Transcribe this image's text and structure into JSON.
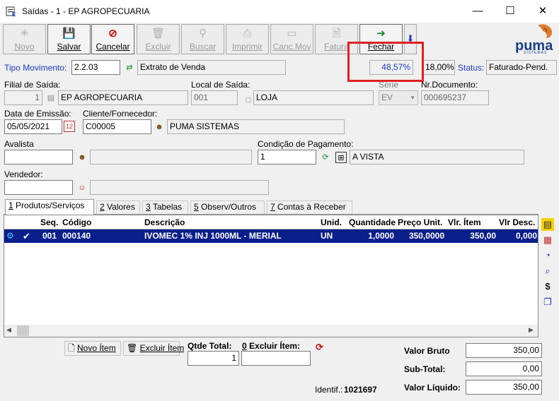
{
  "window": {
    "title": "Saídas - 1 - EP AGROPECUARIA",
    "controls": {
      "minimize": "—",
      "maximize": "☐",
      "close": "✕"
    }
  },
  "toolbar": {
    "novo": "Novo",
    "salvar": "Salvar",
    "cancelar": "Cancelar",
    "excluir": "Excluir",
    "buscar": "Buscar",
    "imprimir": "Imprimir",
    "canc_mov": "Canc.Mov",
    "fatura": "Fatura",
    "fechar": "Fechar",
    "logo_brand": "puma",
    "logo_sub": "SISTEMAS"
  },
  "header": {
    "tipo_label": "Tipo Movimento:",
    "tipo_value": "2.2.03",
    "tipo_desc": "Extrato de Venda",
    "pct1": "48,57%",
    "pct2": "18,00%",
    "status_label": "Status:",
    "status_value": "Faturado-Pend."
  },
  "form": {
    "filial_label": "Filial de Saída:",
    "filial_code": "1",
    "filial_name": "EP AGROPECUARIA",
    "local_label": "Local de Saída:",
    "local_code": "001",
    "local_name": "LOJA",
    "serie_label": "Série",
    "serie_value": "EV",
    "nrdoc_label": "Nr.Documento:",
    "nrdoc_value": "000695237",
    "emissao_label": "Data de Emissão:",
    "emissao_value": "05/05/2021",
    "cliente_label": "Cliente/Fornecedor:",
    "cliente_code": "C00005",
    "cliente_name": "PUMA SISTEMAS",
    "avalista_label": "Avalista",
    "avalista_value": "",
    "avalista_name": "",
    "condicao_label": "Condição de Pagamento:",
    "condicao_code": "1",
    "condicao_name": "A VISTA",
    "vendedor_label": "Vendedor:",
    "vendedor_value": "",
    "vendedor_name": ""
  },
  "tabs": [
    {
      "key": "1",
      "label": "Produtos/Serviços"
    },
    {
      "key": "2",
      "label": "Valores"
    },
    {
      "key": "3",
      "label": "Tabelas"
    },
    {
      "key": "5",
      "label": "Observ/Outros"
    },
    {
      "key": "7",
      "label": "Contas à Receber"
    }
  ],
  "grid": {
    "headers": [
      "Seq.",
      "Código",
      "Descrição",
      "Unid.",
      "Quantidade",
      "Preço Unit.",
      "Vlr. Ítem",
      "Vlr Desc."
    ],
    "rows": [
      {
        "seq": "001",
        "codigo": "000140",
        "descricao": "IVOMEC 1% INJ 1000ML - MERIAL",
        "unid": "UN",
        "quantidade": "1,0000",
        "preco": "350,0000",
        "vlr_item": "350,00",
        "vlr_desc": "0,000"
      }
    ]
  },
  "footer": {
    "novo_item": "Novo Ítem",
    "excluir_item": "Excluir Ítem",
    "qtde_label": "Qtde Total:",
    "qtde_value": "1",
    "excluir_label_num": "0",
    "excluir_label": "Excluir Ítem:",
    "excluir_value": "",
    "identif_label": "Identif.:",
    "identif_value": "1021697",
    "valor_bruto_label": "Valor Bruto",
    "valor_bruto": "350,00",
    "subtotal_label": "Sub-Total:",
    "subtotal": "0,00",
    "valor_liquido_label": "Valor Líquido:",
    "valor_liquido": "350,00"
  },
  "colors": {
    "highlight_box": "#e02020",
    "selection": "#0a1e8c",
    "label_blue": "#1a3cc8"
  }
}
